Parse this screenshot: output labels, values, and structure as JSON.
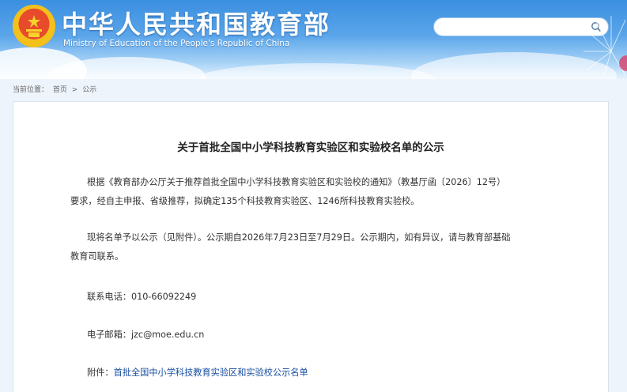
{
  "header": {
    "site_title": "中华人民共和国教育部",
    "site_subtitle": "Ministry of Education of the People's Republic of China",
    "search": {
      "placeholder": "",
      "value": "",
      "icon": "search-icon"
    },
    "emblem": "national-emblem-icon"
  },
  "breadcrumb": {
    "prefix": "当前位置：",
    "items": [
      "首页",
      "公示"
    ],
    "separator": ">"
  },
  "article": {
    "title": "关于首批全国中小学科技教育实验区和实验校名单的公示",
    "para1_line1": "根据《教育部办公厅关于推荐首批全国中小学科技教育实验区和实验校的通知》（教基厅函〔2026〕12号）",
    "para1_line2": "要求，经自主申报、省级推荐，拟确定135个科技教育实验区、1246所科技教育实验校。",
    "para2_line1": "现将名单予以公示（见附件）。公示期自2026年7月23日至7月29日。公示期内，如有异议，请与教育部基础",
    "para2_line2": "教育司联系。",
    "phone_label": "联系电话：",
    "phone": "010-66092249",
    "email_label": "电子邮箱：",
    "email": "jzc@moe.edu.cn",
    "attachment_label": "附件：",
    "attachment_link": "首批全国中小学科技教育实验区和实验校公示名单"
  },
  "colors": {
    "banner_top": "#3b8fe0",
    "link": "#1a4fa0",
    "text": "#333333"
  }
}
